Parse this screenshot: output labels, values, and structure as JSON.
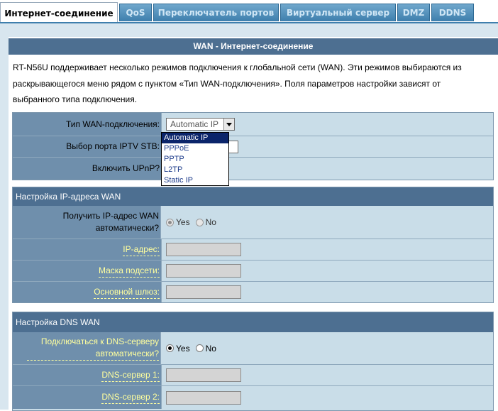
{
  "tabs": [
    {
      "label": "Интернет-соединение",
      "active": true
    },
    {
      "label": "QoS"
    },
    {
      "label": "Переключатель портов"
    },
    {
      "label": "Виртуальный сервер"
    },
    {
      "label": "DMZ"
    },
    {
      "label": "DDNS"
    }
  ],
  "main": {
    "title": "WAN - Интернет-соединение",
    "description": "RT-N56U поддерживает несколько режимов подключения к глобальной сети (WAN). Эти режимов выбираются из раскрывающегося меню рядом с пунктом «Тип WAN-подключения». Поля параметров настройки зависят от выбранного типа подключения."
  },
  "general": {
    "wan_type_label": "Тип WAN-подключения:",
    "wan_type_value": "Automatic IP",
    "wan_type_options": [
      "Automatic IP",
      "PPPoE",
      "PPTP",
      "L2TP",
      "Static IP"
    ],
    "iptv_label": "Выбор порта IPTV STB:",
    "upnp_label": "Включить UPnP?"
  },
  "ip_section": {
    "title": "Настройка IP-адреса WAN",
    "auto_ip_label": "Получить IP-адрес WAN автоматически?",
    "yes": "Yes",
    "no": "No",
    "ip_label": "IP-адрес:",
    "mask_label": "Маска подсети:",
    "gateway_label": "Основной шлюз:"
  },
  "dns_section": {
    "title": "Настройка DNS WAN",
    "auto_dns_label": "Подключаться к DNS-серверу автоматически?",
    "yes": "Yes",
    "no": "No",
    "dns1_label": "DNS-сервер 1:",
    "dns2_label": "DNS-сервер 2:"
  },
  "colors": {
    "header_bg": "#4d6f91",
    "label_bg": "#6f8fac",
    "row_bg": "#c9dde8",
    "link_text": "#ffff9e"
  }
}
